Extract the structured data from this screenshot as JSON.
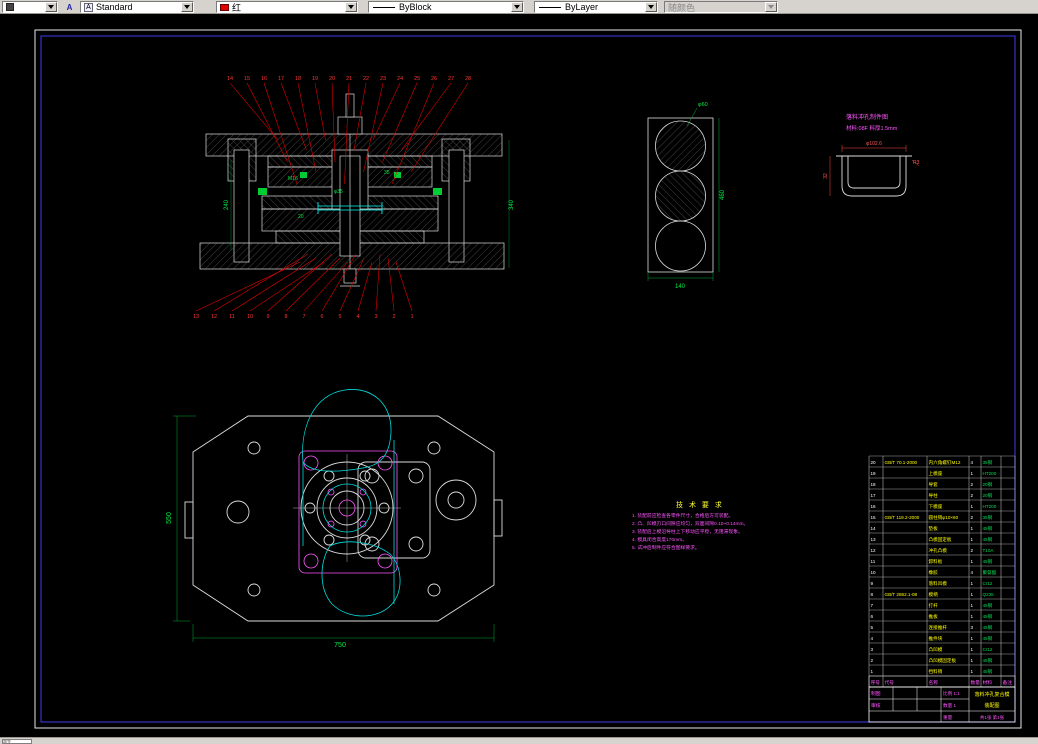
{
  "toolbar": {
    "style_value": "Standard",
    "color_value": "红",
    "lineweight_value": "ByBlock",
    "linetype_value": "ByLayer",
    "plotstyle_value": "随颜色",
    "style_icon_glyph": "A"
  },
  "status": {
    "fragment": "命令"
  },
  "section": {
    "top_callouts": [
      "14",
      "15",
      "16",
      "17",
      "18",
      "19",
      "20",
      "21",
      "22",
      "23",
      "24",
      "25",
      "26",
      "27",
      "28"
    ],
    "bottom_callouts": [
      "13",
      "12",
      "11",
      "10",
      "9",
      "8",
      "7",
      "6",
      "5",
      "4",
      "3",
      "2",
      "1"
    ],
    "dims": {
      "left": "240",
      "right": "340",
      "d1": "M16",
      "d2": "φ35",
      "d3": "20",
      "d4": "35"
    }
  },
  "strip": {
    "dim_bottom": "140",
    "dim_right": "460",
    "dim_circle": "φ60"
  },
  "part": {
    "title": "落料冲孔制件图",
    "subtitle": "材料:08F  料厚1.5mm",
    "dim_top": "φ102.6",
    "dim_left": "32",
    "dim_r": "R3"
  },
  "plan": {
    "dim_width": "750",
    "dim_height": "550"
  },
  "tech": {
    "title": "技 术 要 求",
    "lines": [
      "1. 装配前应检查各零件尺寸，合格后方可装配。",
      "2. 凸、凹模刃口间隙应均匀，双面间隙0.10~0.14mm。",
      "3. 装配后上模沿导柱上下移动应平稳，无阻滞现象。",
      "4. 模具闭合高度170mm。",
      "5. 试冲后制件应符合图样要求。"
    ]
  },
  "bom": {
    "header": [
      "序号",
      "代号",
      "名称",
      "数量",
      "材料",
      "备注"
    ],
    "rows": [
      [
        "20",
        "GB/T 70.1-2000",
        "内六角螺钉M12",
        "4",
        "35钢",
        ""
      ],
      [
        "19",
        "",
        "上模座",
        "1",
        "HT200",
        ""
      ],
      [
        "18",
        "",
        "导套",
        "2",
        "20钢",
        ""
      ],
      [
        "17",
        "",
        "导柱",
        "2",
        "20钢",
        ""
      ],
      [
        "16",
        "",
        "下模座",
        "1",
        "HT200",
        ""
      ],
      [
        "15",
        "GB/T 119.2-2000",
        "圆柱销φ10×60",
        "2",
        "35钢",
        ""
      ],
      [
        "14",
        "",
        "垫板",
        "1",
        "45钢",
        ""
      ],
      [
        "13",
        "",
        "凸模固定板",
        "1",
        "45钢",
        ""
      ],
      [
        "12",
        "",
        "冲孔凸模",
        "2",
        "T10A",
        ""
      ],
      [
        "11",
        "",
        "卸料板",
        "1",
        "45钢",
        ""
      ],
      [
        "10",
        "",
        "橡胶",
        "4",
        "聚氨酯",
        ""
      ],
      [
        "9",
        "",
        "落料凹模",
        "1",
        "Cr12",
        ""
      ],
      [
        "8",
        "GB/T 2862.1-08",
        "模柄",
        "1",
        "Q235",
        ""
      ],
      [
        "7",
        "",
        "打杆",
        "1",
        "45钢",
        ""
      ],
      [
        "6",
        "",
        "推板",
        "1",
        "45钢",
        ""
      ],
      [
        "5",
        "",
        "连接推杆",
        "3",
        "45钢",
        ""
      ],
      [
        "4",
        "",
        "推件块",
        "1",
        "45钢",
        ""
      ],
      [
        "3",
        "",
        "凸凹模",
        "1",
        "Cr12",
        ""
      ],
      [
        "2",
        "",
        "凸凹模固定板",
        "1",
        "45钢",
        ""
      ],
      [
        "1",
        "",
        "挡料销",
        "1",
        "45钢",
        ""
      ]
    ]
  },
  "titleblock": {
    "title": "落料冲孔复合模",
    "subtitle": "装配图",
    "draw_label": "制图",
    "check_label": "审核",
    "scale_row": "比例 1:1",
    "qty_row": "数量 1",
    "weight_row": "重量",
    "sheet": "共1张 第1张"
  }
}
